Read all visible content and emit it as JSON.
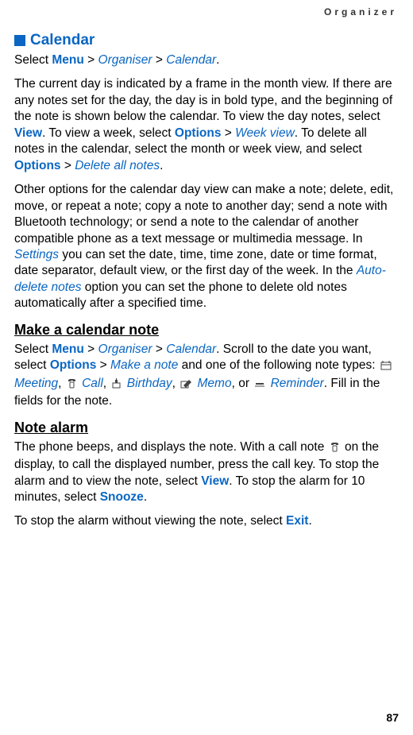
{
  "header": {
    "label": "Organizer"
  },
  "section1": {
    "title": "Calendar",
    "select_prefix": "Select ",
    "menu": "Menu",
    "gt1": " > ",
    "organiser": "Organiser",
    "gt2": " > ",
    "calendar": "Calendar",
    "period": ".",
    "p1_a": "The current day is indicated by a frame in the month view. If there are any notes set for the day, the day is in bold type, and the beginning of the note is shown below the calendar. To view the day notes, select ",
    "view": "View",
    "p1_b": ". To view a week, select ",
    "options1": "Options",
    "gt3": " > ",
    "weekview": "Week view",
    "p1_c": ". To delete all notes in the calendar, select the month or week view, and select ",
    "options2": "Options",
    "gt4": " > ",
    "deleteall": "Delete all notes",
    "p1_d": ".",
    "p2_a": "Other options for the calendar day view can make a note; delete, edit, move, or repeat a note; copy a note to another day; send a note with Bluetooth technology; or send a note to the calendar of another compatible phone as a text message or multimedia message. In ",
    "settings": "Settings",
    "p2_b": " you can set the date, time, time zone, date or time format, date separator, default view, or the first day of the week. In the ",
    "autodel": "Auto-delete notes",
    "p2_c": " option you can set the phone to delete old notes automatically after a specified time."
  },
  "section2": {
    "title": "Make a calendar note",
    "p1_a": "Select ",
    "menu": "Menu",
    "gt1": " > ",
    "organiser": "Organiser",
    "gt2": " > ",
    "calendar": "Calendar",
    "p1_b": ". Scroll to the date you want, select ",
    "options": "Options",
    "gt3": " > ",
    "makenote": "Make a note",
    "p1_c": " and one of the following note types: ",
    "meeting": " Meeting",
    "comma1": ", ",
    "call": " Call",
    "comma2": ", ",
    "birthday": " Birthday",
    "comma3": ", ",
    "memo": " Memo",
    "comma4": ", or ",
    "reminder": " Reminder",
    "p1_d": ". Fill in the fields for the note."
  },
  "section3": {
    "title": "Note alarm",
    "p1_a": "The phone beeps, and displays the note. With a call note ",
    "p1_b": " on the display, to call the displayed number, press the call key. To stop the alarm and to view the note, select ",
    "view": "View",
    "p1_c": ". To stop the alarm for 10 minutes, select ",
    "snooze": "Snooze",
    "p1_d": ".",
    "p2_a": "To stop the alarm without viewing the note, select ",
    "exit": "Exit",
    "p2_b": "."
  },
  "page": {
    "number": "87"
  }
}
